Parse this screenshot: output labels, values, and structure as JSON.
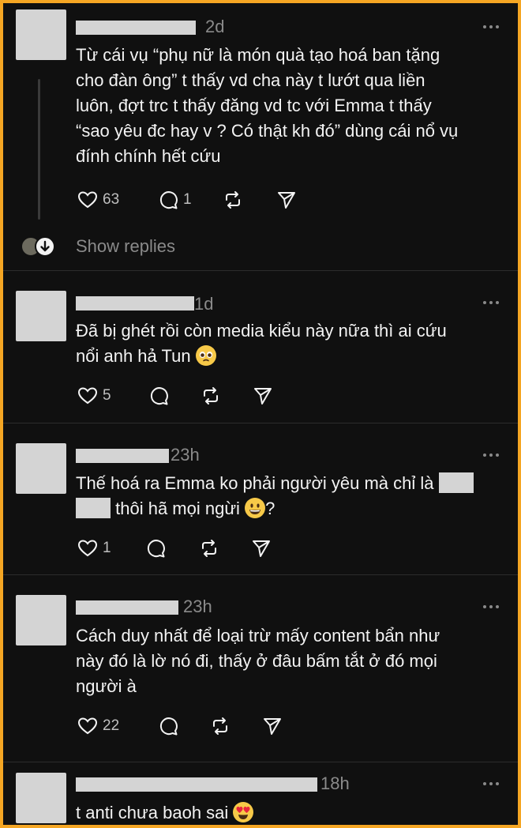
{
  "posts": [
    {
      "time": "2d",
      "text_lines": [
        "Từ cái vụ “phụ nữ là món quà tạo hoá ban tặng",
        "cho đàn ông” t thấy vd cha này t lướt qua liền",
        "luôn, đợt trc t thấy đăng vd tc với Emma t thấy",
        "“sao yêu đc hay v ? Có thật kh đó” dùng cái nổ vụ",
        "đính chính hết cứu"
      ],
      "likes": "63",
      "comments": "1",
      "show_replies": "Show replies"
    },
    {
      "time": "1d",
      "text_line1": "Đã bị ghét rồi còn media kiểu này nữa thì ai cứu",
      "text_line2": "nổi anh hả Tun",
      "emoji": "pleading-face",
      "likes": "5"
    },
    {
      "time": "23h",
      "text_line1": "Thế hoá ra Emma ko phải người yêu mà chỉ là",
      "text_line2": "thôi hã mọi ngừi",
      "text_line2_end": "?",
      "emoji": "grinning-face",
      "likes": "1"
    },
    {
      "time": "23h",
      "text_lines": [
        "Cách duy nhất để loại trừ mấy content bẩn như",
        "này đó là lờ nó đi, thấy ở đâu bấm tắt ở đó mọi",
        "người à"
      ],
      "likes": "22"
    },
    {
      "time": "18h",
      "text_line1": "t anti chưa baoh sai",
      "emoji": "heart-eyes-face"
    }
  ],
  "colors": {
    "background": "#101010",
    "border": "#f5a623",
    "text": "#f3f3f3",
    "muted": "#8a8a8a",
    "redaction": "#d4d4d4"
  }
}
